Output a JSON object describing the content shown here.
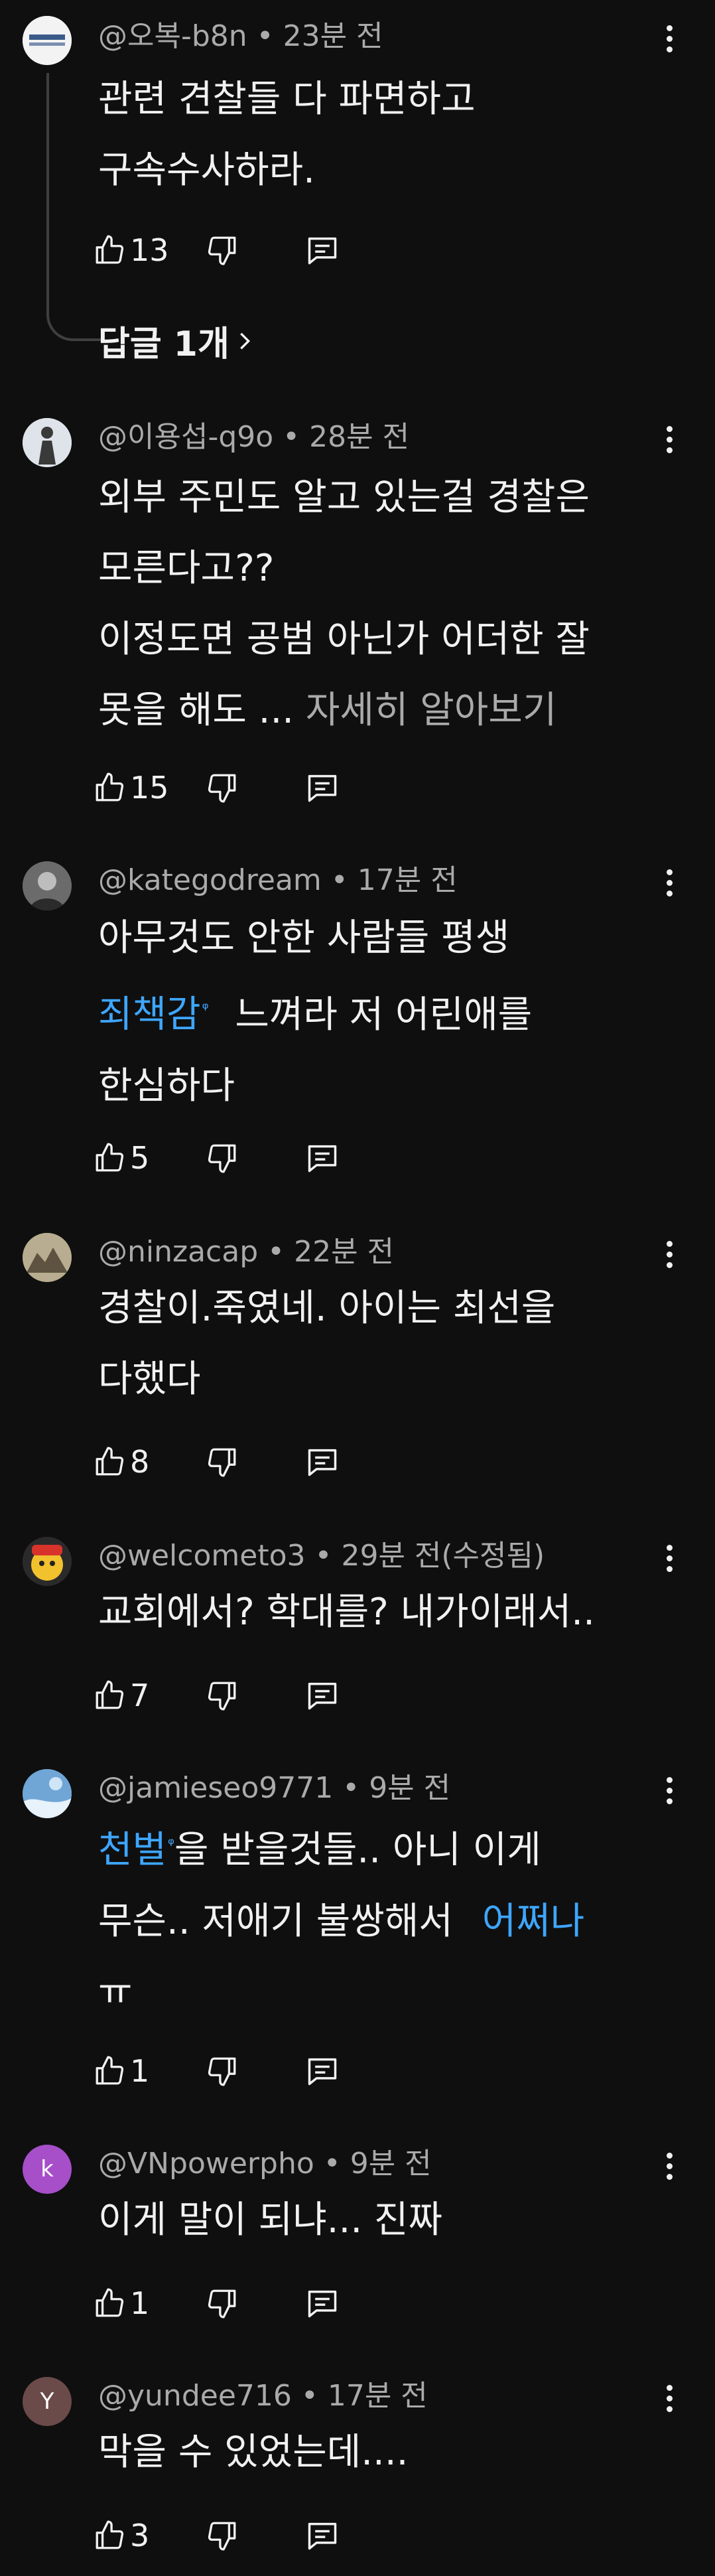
{
  "colors": {
    "background": "#0f0f0f",
    "text": "#f1f1f1",
    "meta": "#aaaaaa",
    "link": "#3ea6ff"
  },
  "comments": [
    {
      "handle": "@오복-b8n",
      "time": "23분 전",
      "lines": [
        "관련 견찰들 다 파면하고",
        "구속수사하라."
      ],
      "likes": "13",
      "replies": "답글 1개"
    },
    {
      "handle": "@이용섭-q9o",
      "time": "28분 전",
      "lines": [
        "외부 주민도 알고 있는걸 경찰은",
        "모른다고??",
        "이정도면 공범 아닌가 어더한 잘"
      ],
      "line4_text": "못을 해도 ...",
      "read_more": "자세히 알아보기",
      "likes": "15"
    },
    {
      "handle": "@kategodream",
      "time": "17분 전",
      "line1": "아무것도 안한 사람들 평생",
      "link1": "죄책감",
      "line2_rest": "느껴라 저 어린애를",
      "line3": "한심하다",
      "likes": "5"
    },
    {
      "handle": "@ninzacap",
      "time": "22분 전",
      "lines": [
        "경찰이.죽였네. 아이는 최선을",
        "다했다"
      ],
      "likes": "8"
    },
    {
      "handle": "@welcometo3",
      "time": "29분 전(수정됨)",
      "lines": [
        "교회에서? 학대를? 내가이래서.."
      ],
      "likes": "7"
    },
    {
      "handle": "@jamieseo9771",
      "time": "9분 전",
      "link1": "천벌",
      "line1_rest": "을 받을것들.. 아니 이게",
      "line2": "무슨..  저애기 불쌍해서",
      "link2": "어쩌나",
      "line3": "ㅠ",
      "likes": "1"
    },
    {
      "handle": "@VNpowerpho",
      "time": "9분 전",
      "avatar_letter": "k",
      "lines": [
        "이게 말이 되냐... 진짜"
      ],
      "likes": "1"
    },
    {
      "handle": "@yundee716",
      "time": "17분 전",
      "avatar_letter": "Y",
      "lines": [
        "막을 수 있었는데...."
      ],
      "likes": "3"
    }
  ],
  "icons": {
    "menu": "more-vert-icon",
    "like": "thumb-up-icon",
    "dislike": "thumb-down-icon",
    "reply": "reply-icon",
    "chevron": "chevron-right-icon"
  }
}
